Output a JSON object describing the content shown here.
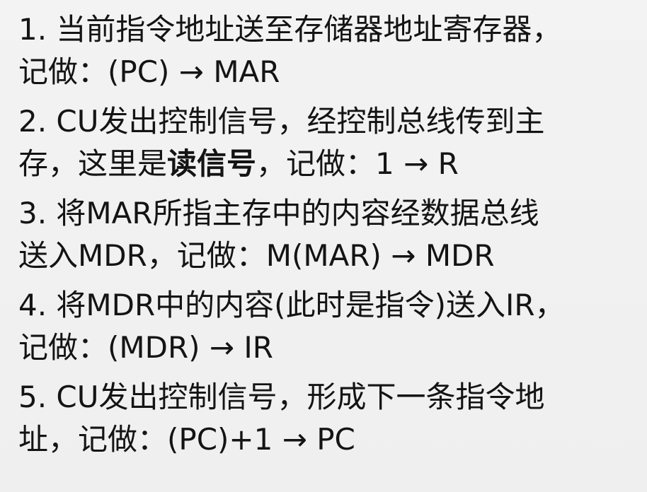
{
  "steps": [
    {
      "line1": "1. 当前指令地址送至存储器地址寄存器，",
      "line2": "记做：(PC) → MAR"
    },
    {
      "line1": "2. CU发出控制信号，经控制总线传到主",
      "line2_before": "存，这里是",
      "line2_emph": "读信号",
      "line2_after": "，记做：1 → R"
    },
    {
      "line1": "3. 将MAR所指主存中的内容经数据总线",
      "line2": "送入MDR，记做：M(MAR) → MDR"
    },
    {
      "line1": "4. 将MDR中的内容(此时是指令)送入IR，",
      "line2": "记做：(MDR) → IR"
    },
    {
      "line1": "5. CU发出控制信号，形成下一条指令地",
      "line2": "址，记做：(PC)+1 → PC"
    }
  ]
}
